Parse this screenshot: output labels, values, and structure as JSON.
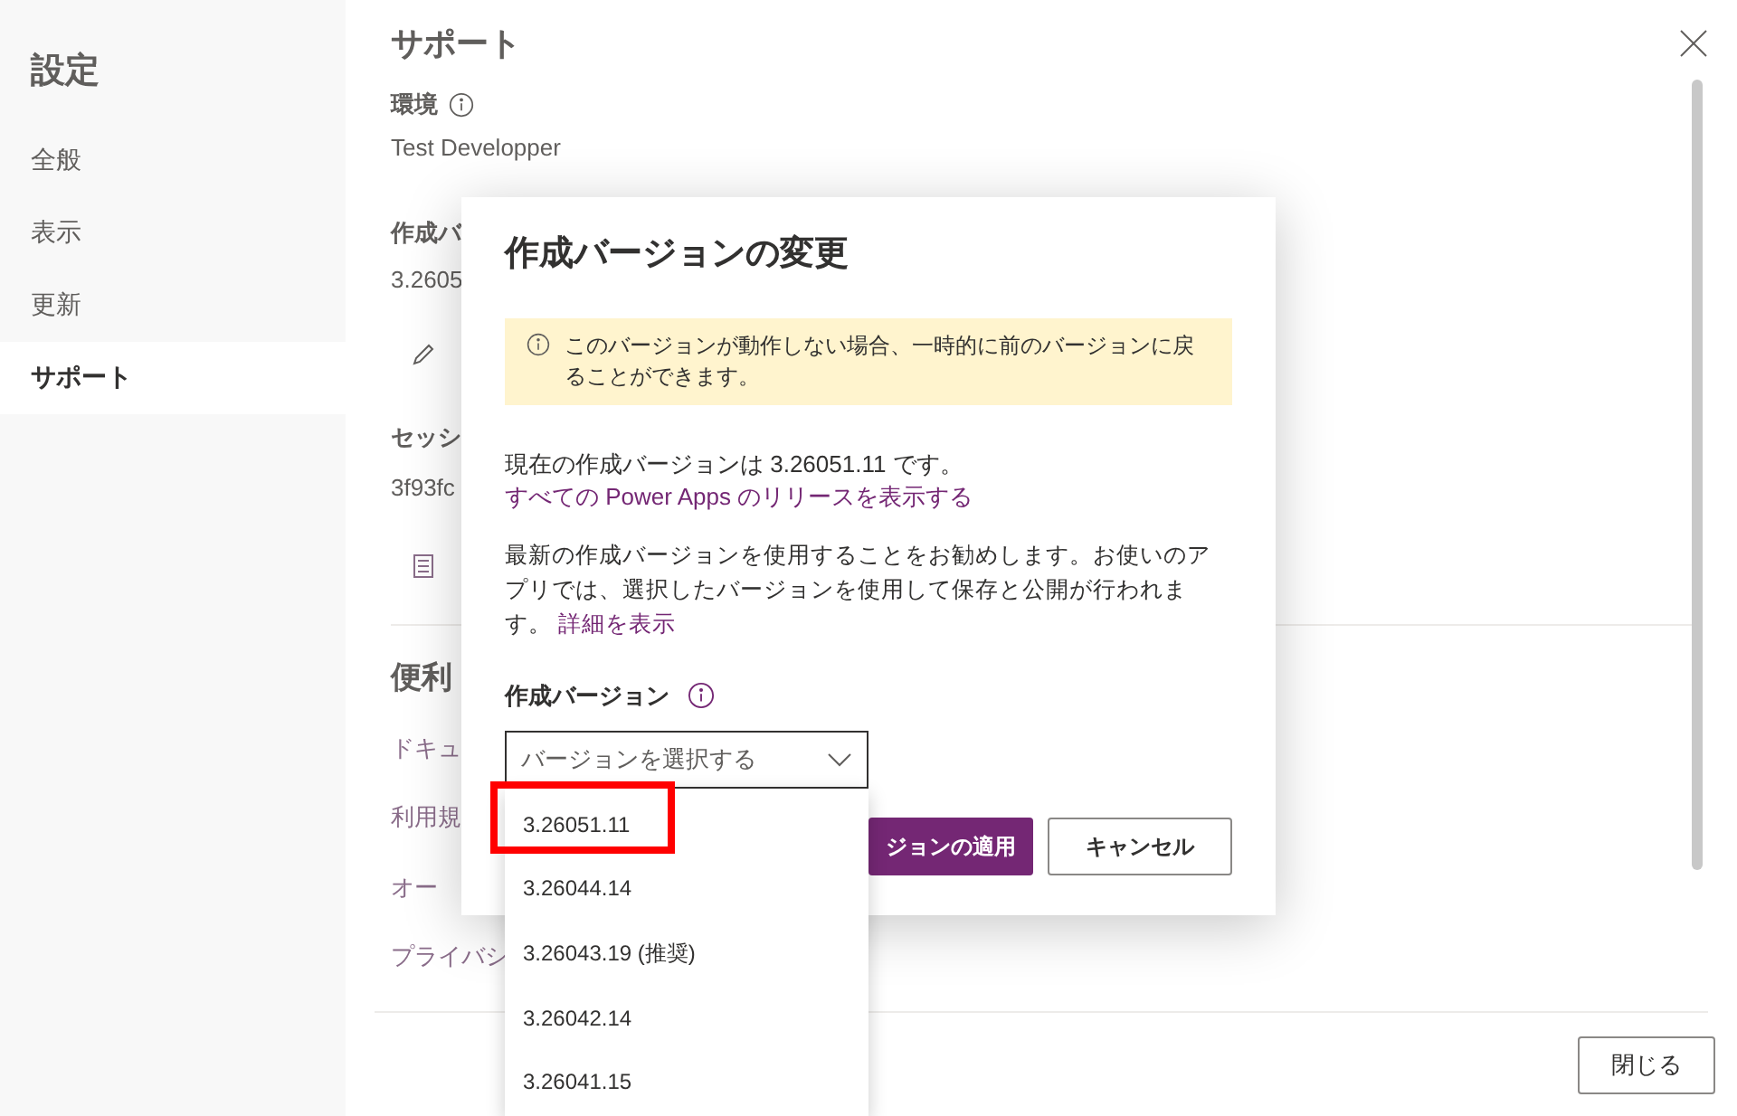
{
  "sidebar": {
    "title": "設定",
    "items": [
      {
        "label": "全般",
        "selected": false
      },
      {
        "label": "表示",
        "selected": false
      },
      {
        "label": "更新",
        "selected": false
      },
      {
        "label": "サポート",
        "selected": true
      }
    ]
  },
  "panel": {
    "title": "サポート",
    "environment": {
      "label": "環境",
      "value": "Test Developper"
    },
    "authoring": {
      "label": "作成バ",
      "value": "3.2605"
    },
    "session": {
      "label": "セッシ",
      "value": "3f93fc"
    },
    "useful": {
      "title": "便利",
      "links": [
        "ドキュ",
        "利用規",
        "オー",
        "プライバシ"
      ]
    },
    "close_button": "閉じる"
  },
  "dialog": {
    "title": "作成バージョンの変更",
    "warning": "このバージョンが動作しない場合、一時的に前のバージョンに戻ることができます。",
    "current": {
      "text": "現在の作成バージョンは 3.26051.11 です。",
      "link": "すべての Power Apps のリリースを表示する"
    },
    "recommend": {
      "text": "最新の作成バージョンを使用することをお勧めします。お使いのアプリでは、選択したバージョンを使用して保存と公開が行われます。",
      "link": "詳細を表示"
    },
    "field_label": "作成バージョン",
    "select": {
      "placeholder": "バージョンを選択する",
      "expanded": true,
      "options": [
        {
          "label": "3.26051.11",
          "highlighted": true
        },
        {
          "label": "3.26044.14",
          "highlighted": false
        },
        {
          "label": "3.26043.19 (推奨)",
          "highlighted": false
        },
        {
          "label": "3.26042.14",
          "highlighted": false
        },
        {
          "label": "3.26041.15",
          "highlighted": false
        }
      ]
    },
    "apply_button": "ジョンの適用",
    "cancel_button": "キャンセル"
  }
}
